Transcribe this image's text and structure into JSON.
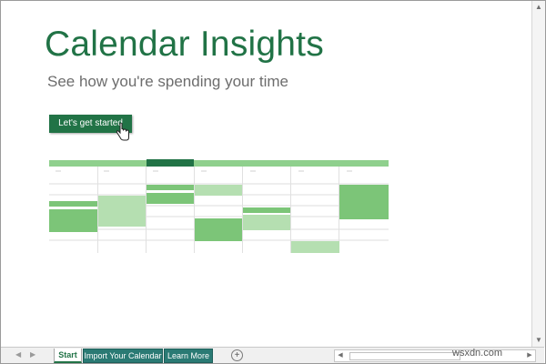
{
  "content": {
    "title": "Calendar Insights",
    "subtitle": "See how you're spending your time",
    "start_button": "Let's get started"
  },
  "sheet_tabs": [
    {
      "label": "Start",
      "active": true
    },
    {
      "label": "Import Your Calendar",
      "active": false
    },
    {
      "label": "Learn More",
      "active": false
    }
  ],
  "icons": {
    "cursor": "hand-pointer-icon",
    "add_sheet": "plus-circle-icon",
    "scroll_up": "arrow-up-icon",
    "scroll_down": "arrow-down-icon",
    "scroll_left": "arrow-left-icon",
    "scroll_right": "arrow-right-icon",
    "sheet_prev": "sheet-prev-icon",
    "sheet_next": "sheet-next-icon"
  },
  "watermark": "wsxdn.com",
  "colors": {
    "accent_green": "#217346",
    "light_green": "#8fd08d",
    "mid_green": "#7cc578",
    "pale_green": "#b5dfb1",
    "tab_teal": "#2a7a74"
  }
}
